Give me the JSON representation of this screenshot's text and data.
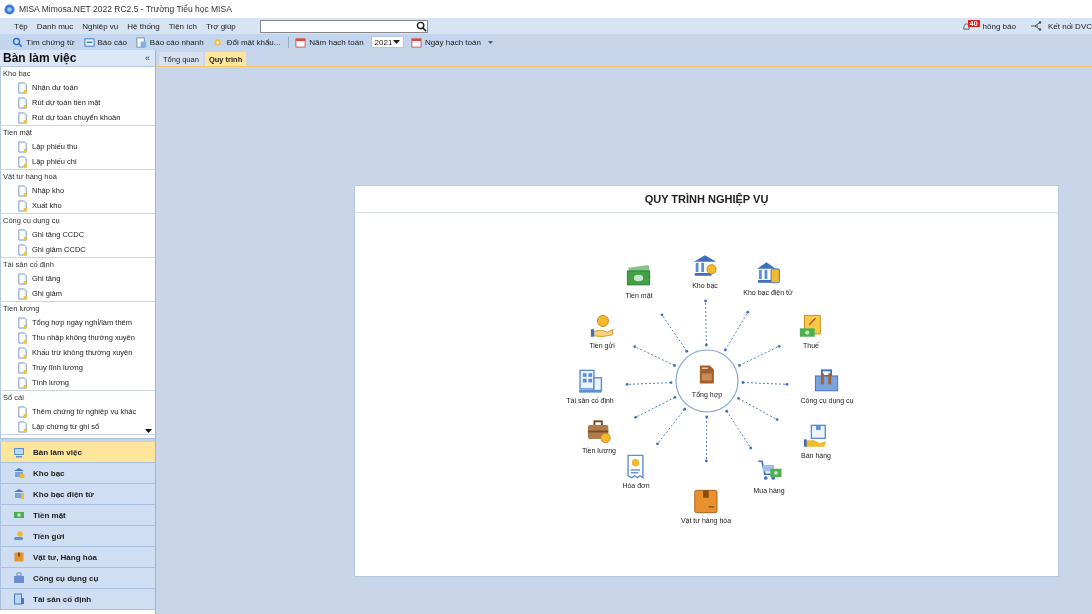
{
  "window": {
    "title": "MISA Mimosa.NET 2022 RC2.5 - Trường Tiểu học MISA"
  },
  "menu": [
    "Tệp",
    "Danh mục",
    "Nghiệp vụ",
    "Hệ thống",
    "Tiện ích",
    "Trợ giúp"
  ],
  "notifications": {
    "badge": "40",
    "label": "hông báo"
  },
  "connect": {
    "label": "Kết nối DVC"
  },
  "toolbar": {
    "actions": [
      "Tìm chứng từ",
      "Báo cáo",
      "Báo cáo nhanh",
      "Đổi mật khẩu..."
    ],
    "year_label": "Năm hạch toán",
    "year": "2021",
    "date_label": "Ngày hạch toán"
  },
  "sidebar": {
    "title": "Bàn làm việc",
    "collapse": "«",
    "groups": [
      {
        "label": "Kho bạc",
        "children": [
          {
            "label": "Nhận dự toán"
          },
          {
            "label": "Rút dự toán tiền mặt"
          },
          {
            "label": "Rút dự toán chuyển khoản"
          }
        ]
      },
      {
        "label": "Tiền mặt",
        "children": [
          {
            "label": "Lập phiếu thu"
          },
          {
            "label": "Lập phiếu chi"
          }
        ]
      },
      {
        "label": "Vật tư hàng hoá",
        "children": [
          {
            "label": "Nhập kho"
          },
          {
            "label": "Xuất kho"
          }
        ]
      },
      {
        "label": "Công cụ dụng cụ",
        "children": [
          {
            "label": "Ghi tăng CCDC"
          },
          {
            "label": "Ghi giảm CCDC"
          }
        ]
      },
      {
        "label": "Tài sản cố định",
        "children": [
          {
            "label": "Ghi tăng"
          },
          {
            "label": "Ghi giảm"
          }
        ]
      },
      {
        "label": "Tiền lương",
        "children": [
          {
            "label": "Tổng hợp ngày nghỉ/làm thêm"
          },
          {
            "label": "Thu nhập không thường xuyên"
          },
          {
            "label": "Khấu trừ không thường xuyên"
          },
          {
            "label": "Truy lĩnh lương"
          },
          {
            "label": "Tính lương"
          }
        ]
      },
      {
        "label": "Sổ cái",
        "children": [
          {
            "label": "Thêm chứng từ nghiệp vụ khác"
          },
          {
            "label": "Lập chứng từ ghi sổ"
          }
        ]
      }
    ],
    "nav": [
      {
        "label": "Bàn làm việc",
        "selected": true
      },
      {
        "label": "Kho bạc",
        "selected": false
      },
      {
        "label": "Kho bạc điện tử",
        "selected": false
      },
      {
        "label": "Tiền mặt",
        "selected": false
      },
      {
        "label": "Tiền gửi",
        "selected": false
      },
      {
        "label": "Vật tư, Hàng hóa",
        "selected": false
      },
      {
        "label": "Công cụ dụng cụ",
        "selected": false
      },
      {
        "label": "Tài sản cố định",
        "selected": false
      }
    ]
  },
  "tabs": [
    {
      "label": "Tổng quan",
      "selected": false
    },
    {
      "label": "Quy trình",
      "selected": true
    }
  ],
  "process": {
    "title": "QUY TRÌNH NGHIỆP VỤ",
    "center": "Tổng hợp",
    "nodes": [
      "Tiền mặt",
      "Kho bạc",
      "Kho bạc điện tử",
      "Tiền gửi",
      "Thuế",
      "Tài sản cố định",
      "Công cụ dụng cụ",
      "Tiền lương",
      "Bán hàng",
      "Hóa đơn",
      "Mua hàng",
      "Vật tư hàng hóa"
    ]
  }
}
